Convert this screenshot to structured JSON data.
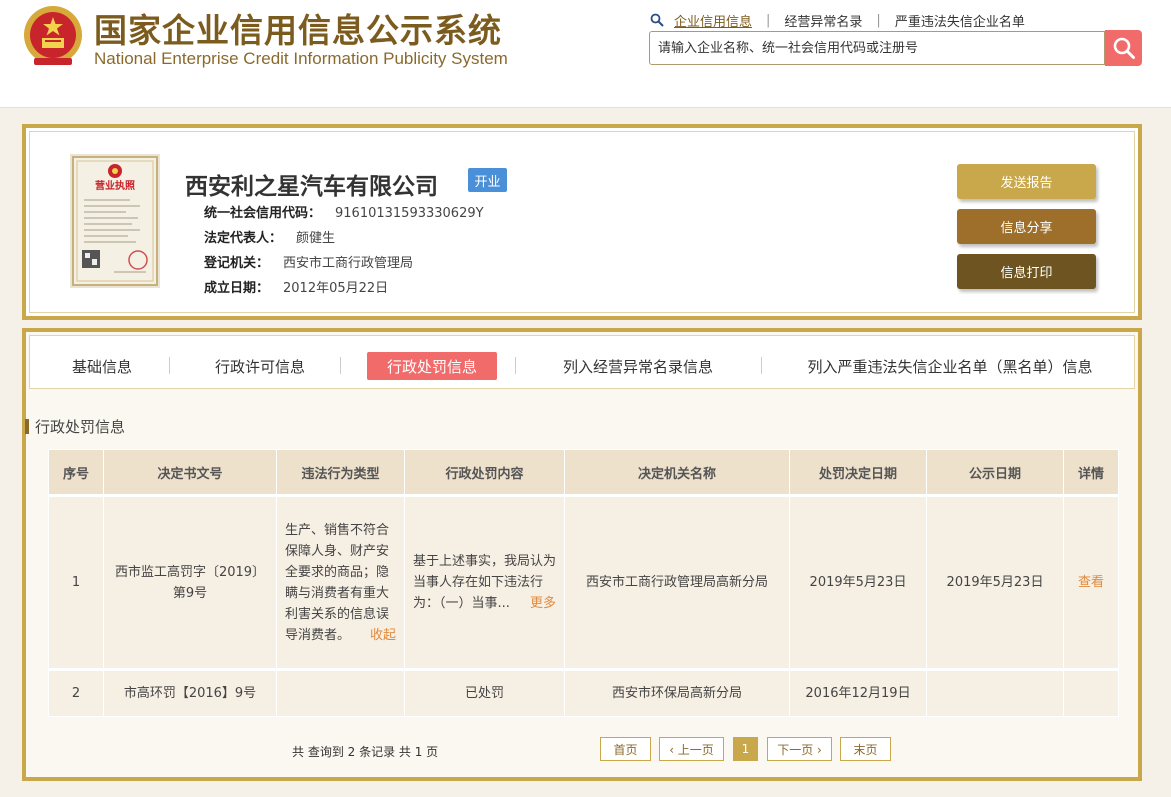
{
  "header": {
    "title_cn": "国家企业信用信息公示系统",
    "title_en": "National Enterprise Credit Information Publicity System",
    "links": [
      "企业信用信息",
      "经营异常名录",
      "严重违法失信企业名单"
    ],
    "search_placeholder": "请输入企业名称、统一社会信用代码或注册号",
    "license_label": "营业执照"
  },
  "company": {
    "name": "西安利之星汽车有限公司",
    "status": "开业",
    "fields": [
      {
        "label": "统一社会信用代码：",
        "value": "91610131593330629Y"
      },
      {
        "label": "法定代表人：",
        "value": "颜健生"
      },
      {
        "label": "登记机关：",
        "value": "西安市工商行政管理局"
      },
      {
        "label": "成立日期：",
        "value": "2012年05月22日"
      }
    ],
    "buttons": [
      "发送报告",
      "信息分享",
      "信息打印"
    ]
  },
  "tabs": [
    "基础信息",
    "行政许可信息",
    "行政处罚信息",
    "列入经营异常名录信息",
    "列入严重违法失信企业名单（黑名单）信息"
  ],
  "section_title": "行政处罚信息",
  "table": {
    "headers": [
      "序号",
      "决定书文号",
      "违法行为类型",
      "行政处罚内容",
      "决定机关名称",
      "处罚决定日期",
      "公示日期",
      "详情"
    ],
    "rows": [
      {
        "no": "1",
        "doc": "西市监工高罚字〔2019〕第9号",
        "type": "生产、销售不符合保障人身、财产安全要求的商品；隐瞒与消费者有重大利害关系的信息误导消费者。",
        "type_toggle": "收起",
        "content": "基于上述事实，我局认为当事人存在如下违法行为：（一）当事...",
        "content_toggle": "更多",
        "authority": "西安市工商行政管理局高新分局",
        "decision_date": "2019年5月23日",
        "publish_date": "2019年5月23日",
        "detail": "查看"
      },
      {
        "no": "2",
        "doc": "市高环罚【2016】9号",
        "type": "",
        "content": "已处罚",
        "authority": "西安市环保局高新分局",
        "decision_date": "2016年12月19日",
        "publish_date": "",
        "detail": ""
      }
    ]
  },
  "pagination": {
    "summary": "共 查询到 2 条记录 共 1 页",
    "first": "首页",
    "prev": "‹ 上一页",
    "current": "1",
    "next": "下一页 ›",
    "last": "末页"
  },
  "colors": {
    "gold": "#c9a84c",
    "brand_brown": "#7c5c1e",
    "accent_red": "#f26b6b",
    "badge_blue": "#4a90d9"
  },
  "icons": [
    "national-emblem-icon",
    "search-icon",
    "magnifier-icon"
  ]
}
